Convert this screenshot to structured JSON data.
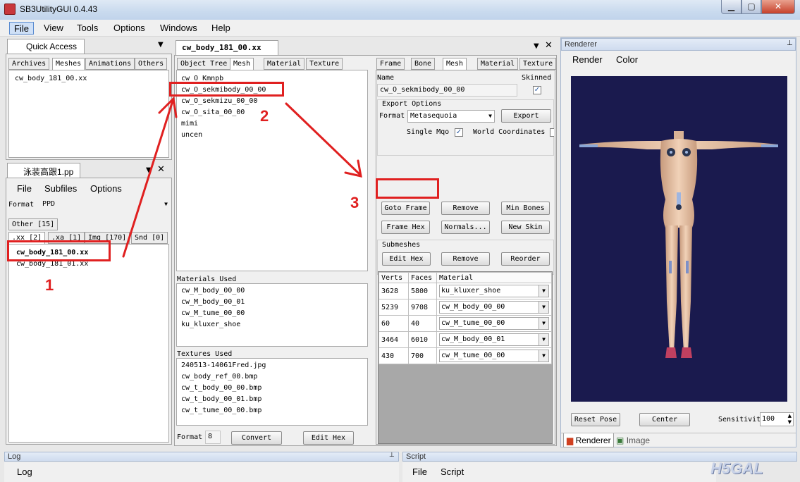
{
  "window": {
    "title": "SB3UtilityGUI 0.4.43"
  },
  "menubar": [
    "File",
    "View",
    "Tools",
    "Options",
    "Windows",
    "Help"
  ],
  "quick_access": {
    "title": "Quick Access",
    "tabs": [
      "Archives",
      "Meshes",
      "Animations",
      "Others"
    ],
    "items": [
      "cw_body_181_00.xx"
    ]
  },
  "pp_panel": {
    "title": "泳装高跟1.pp",
    "menu": [
      "File",
      "Subfiles",
      "Options"
    ],
    "format_label": "Format",
    "format_value": "PPD",
    "tabs_row1": [
      "Other [15]"
    ],
    "tabs_row2": [
      ".xx [2]",
      ".xa [1]",
      "Img [170]",
      "Snd [0]"
    ],
    "files": [
      "cw_body_181_00.xx",
      "cw_body_181_01.xx"
    ]
  },
  "editor": {
    "tab_title": "cw_body_181_00.xx",
    "left_tabs": [
      "Object Tree",
      "Mesh",
      "Material",
      "Texture"
    ],
    "meshes": [
      "cw_O_Kmnpb",
      "cw_O_sekmibody_00_00",
      "cw_O_sekmizu_00_00",
      "cw_O_sita_00_00",
      "mimi",
      "uncen"
    ],
    "materials_label": "Materials Used",
    "materials": [
      "cw_M_body_00_00",
      "cw_M_body_00_01",
      "cw_M_tume_00_00",
      "ku_kluxer_shoe"
    ],
    "textures_label": "Textures Used",
    "textures": [
      "240513-14061Fred.jpg",
      "cw_body_ref_00.bmp",
      "cw_t_body_00_00.bmp",
      "cw_t_body_00_01.bmp",
      "cw_t_tume_00_00.bmp"
    ],
    "format_label": "Format",
    "format_value": "8",
    "convert": "Convert",
    "edit_hex": "Edit Hex"
  },
  "mesh_props": {
    "tabs": [
      "Frame",
      "Bone",
      "Mesh",
      "Material",
      "Texture"
    ],
    "name_label": "Name",
    "name_value": "cw_O_sekmibody_00_00",
    "skinned_label": "Skinned",
    "skinned": true,
    "export_options": "Export Options",
    "format_label": "Format",
    "format_value": "Metasequoia",
    "export": "Export",
    "single_mqo": "Single Mqo",
    "single_mqo_checked": true,
    "world_coords": "World Coordinates",
    "buttons": [
      "Goto Frame",
      "Remove",
      "Min Bones",
      "Frame Hex",
      "Normals...",
      "New Skin"
    ],
    "submeshes_label": "Submeshes",
    "sub_buttons": [
      "Edit Hex",
      "Remove",
      "Reorder"
    ],
    "columns": [
      "Verts",
      "Faces",
      "Material"
    ],
    "rows": [
      {
        "verts": "3628",
        "faces": "5800",
        "material": "ku_kluxer_shoe"
      },
      {
        "verts": "5239",
        "faces": "9708",
        "material": "cw_M_body_00_00"
      },
      {
        "verts": "60",
        "faces": "40",
        "material": "cw_M_tume_00_00"
      },
      {
        "verts": "3464",
        "faces": "6010",
        "material": "cw_M_body_00_01"
      },
      {
        "verts": "430",
        "faces": "700",
        "material": "cw_M_tume_00_00"
      }
    ]
  },
  "renderer": {
    "title": "Renderer",
    "menu": [
      "Render",
      "Color"
    ],
    "reset_pose": "Reset Pose",
    "center": "Center",
    "sensitivity_label": "Sensitivit",
    "sensitivity_value": "100",
    "bottom_tabs": [
      "Renderer",
      "Image"
    ],
    "viewport_color": "#1a1a4e"
  },
  "log": {
    "title": "Log",
    "menu": [
      "Log"
    ]
  },
  "script": {
    "title": "Script",
    "menu": [
      "File",
      "Script"
    ]
  },
  "annotations": {
    "n1": "1",
    "n2": "2",
    "n3": "3",
    "color": "#e02020"
  },
  "watermark": "H5GAL"
}
